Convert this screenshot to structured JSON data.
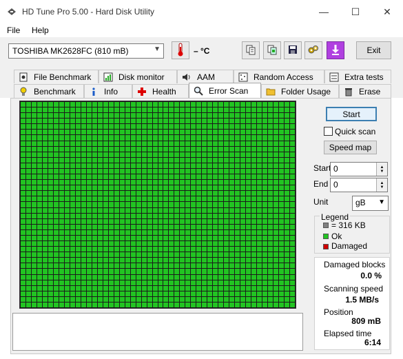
{
  "window": {
    "title": "HD Tune Pro 5.00 - Hard Disk Utility",
    "minimize": "—",
    "maximize": "☐",
    "close": "✕"
  },
  "menu": {
    "file": "File",
    "help": "Help"
  },
  "toolbar": {
    "drive": "TOSHIBA MK2628FC (810 mB)",
    "temperature": "– °C",
    "exit_label": "Exit",
    "icons": [
      "copy-text-icon",
      "copy-screen-icon",
      "save-icon",
      "settings-icon",
      "download-icon"
    ]
  },
  "tabs": {
    "row1": [
      "File Benchmark",
      "Disk monitor",
      "AAM",
      "Random Access",
      "Extra tests"
    ],
    "row2": [
      "Benchmark",
      "Info",
      "Health",
      "Error Scan",
      "Folder Usage",
      "Erase"
    ],
    "active": "Error Scan"
  },
  "controls": {
    "start_label": "Start",
    "quick_scan_label": "Quick scan",
    "quick_scan_checked": false,
    "speed_map_label": "Speed map",
    "start_field_label": "Start",
    "start_value": "0",
    "end_field_label": "End",
    "end_value": "0",
    "unit_label": "Unit",
    "unit_value": "gB"
  },
  "legend": {
    "title": "Legend",
    "block_size": "= 316 KB",
    "ok": "Ok",
    "damaged": "Damaged",
    "colors": {
      "block": "#808080",
      "ok": "#22c422",
      "damaged": "#d00000"
    }
  },
  "stats": {
    "damaged_blocks_label": "Damaged blocks",
    "damaged_blocks_value": "0.0 %",
    "scanning_speed_label": "Scanning speed",
    "scanning_speed_value": "1.5 MB/s",
    "position_label": "Position",
    "position_value": "809 mB",
    "elapsed_label": "Elapsed time",
    "elapsed_value": "6:14"
  },
  "scan_grid": {
    "columns": 50,
    "rows": 37,
    "status": "ok",
    "color": "#22c422"
  }
}
